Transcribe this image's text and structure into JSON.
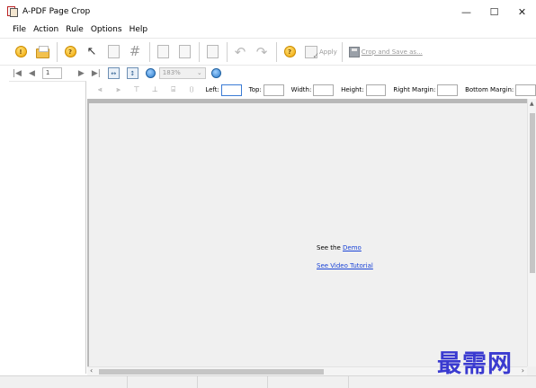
{
  "window": {
    "title": "A-PDF Page Crop",
    "controls": [
      "—",
      "☐",
      "✕"
    ]
  },
  "menu": [
    "File",
    "Action",
    "Rule",
    "Options",
    "Help"
  ],
  "toolbar": {
    "apply_label": "Apply",
    "crop_save_label": "Crop and Save as..."
  },
  "navigation": {
    "page_number": "1",
    "zoom": "183%"
  },
  "crop_fields": {
    "left_label": "Left:",
    "top_label": "Top:",
    "width_label": "Width:",
    "height_label": "Height:",
    "right_margin_label": "Right Margin:",
    "bottom_margin_label": "Bottom Margin:"
  },
  "document": {
    "see_the": "See the",
    "demo_link": "Demo",
    "tutorial_link": "See Video Tutorial"
  },
  "watermark": "最需网",
  "colors": {
    "link": "#1a43d6",
    "watermark": "#3a3ad0",
    "accent": "#f0a400"
  }
}
